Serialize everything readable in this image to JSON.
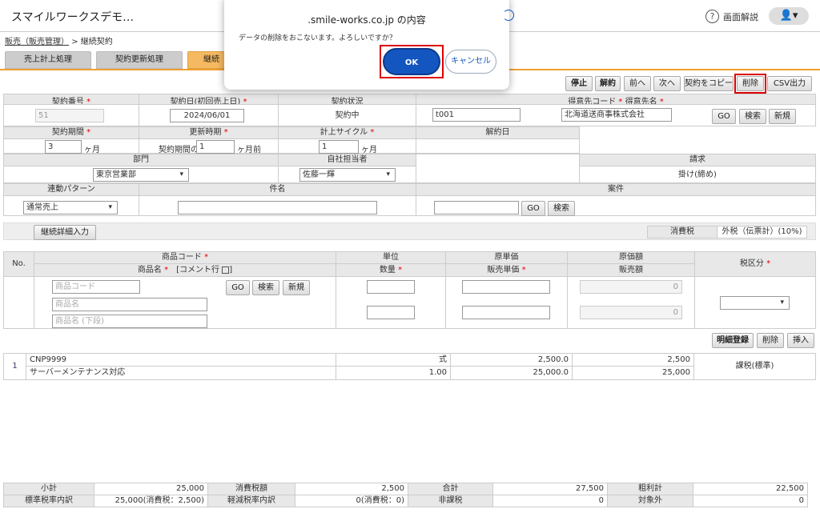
{
  "header": {
    "app_title": "スマイルワークスデモ…",
    "help_label": "画面解説",
    "help_icon": "?",
    "user_icon": "👤▾"
  },
  "breadcrumb": {
    "parent": "販売（販売管理）",
    "sep": ">",
    "current": "継続契約"
  },
  "tabs": [
    "売上計上処理",
    "契約更新処理",
    "継続"
  ],
  "toolbar": {
    "stop": "停止",
    "cancel_contract": "解約",
    "prev": "前へ",
    "next": "次へ",
    "copy": "契約をコピー",
    "delete": "削除",
    "csv": "CSV出力"
  },
  "dialog": {
    "title": ".smile-works.co.jp の内容",
    "message": "データの削除をおこないます。よろしいですか？",
    "ok": "OK",
    "cancel": "キャンセル"
  },
  "form": {
    "contract_no_label": "契約番号",
    "contract_no": "51",
    "contract_date_label": "契約日(初回売上日)",
    "contract_date": "2024/06/01",
    "status_label": "契約状況",
    "status": "契約中",
    "customer_label": "得意先コード",
    "customer_name_label": "得意先名",
    "customer_code": "t001",
    "customer_name": "北海道送商事株式会社",
    "go": "GO",
    "search": "検索",
    "new": "新規",
    "period_label": "契約期間",
    "period": "3",
    "month_unit": "ヶ月",
    "renew_label": "更新時期",
    "renew_prefix": "契約期間の",
    "renew": "1",
    "renew_suffix": "ヶ月前",
    "cycle_label": "計上サイクル",
    "cycle": "1",
    "end_label": "解約日",
    "dept_label": "部門",
    "dept": "東京営業部",
    "staff_label": "自社担当者",
    "staff": "佐藤一輝",
    "bill_label": "請求",
    "bill": "掛け(締め)",
    "pattern_label": "連動パターン",
    "pattern": "通常売上",
    "subject_label": "件名",
    "project_label": "案件",
    "detail_btn": "継続詳細入力",
    "tax_label": "消費税",
    "tax_value": "外税（伝票計）(10%)"
  },
  "items_header": {
    "no": "No.",
    "code": "商品コード",
    "name": "商品名",
    "comment": "[コメント行",
    "unit": "単位",
    "qty": "数量",
    "cost_price": "原単価",
    "sale_price": "販売単価",
    "cost_amt": "原価額",
    "sale_amt": "販売額",
    "tax_type": "税区分"
  },
  "item_entry": {
    "code_ph": "商品コード",
    "name_ph": "商品名",
    "name2_ph": "商品名 (下段)",
    "zero1": "0",
    "zero2": "0"
  },
  "item_actions": {
    "register": "明細登録",
    "delete": "削除",
    "insert": "挿入"
  },
  "lines": [
    {
      "no": "1",
      "code": "CNP9999",
      "name": "サーバーメンテナンス対応",
      "unit": "式",
      "qty": "1.00",
      "cost_price": "2,500.0",
      "sale_price": "25,000.0",
      "cost_amt": "2,500",
      "sale_amt": "25,000",
      "tax": "課税(標準)"
    }
  ],
  "totals": {
    "subtotal_label": "小計",
    "subtotal": "25,000",
    "tax_label": "消費税額",
    "tax": "2,500",
    "total_label": "合計",
    "total": "27,500",
    "profit_label": "粗利計",
    "profit": "22,500",
    "std_label": "標準税率内訳",
    "std": "25,000(消費税：2,500)",
    "red_label": "軽減税率内訳",
    "red": "0(消費税：0)",
    "nontax_label": "非課税",
    "nontax": "0",
    "exempt_label": "対象外",
    "exempt": "0"
  }
}
